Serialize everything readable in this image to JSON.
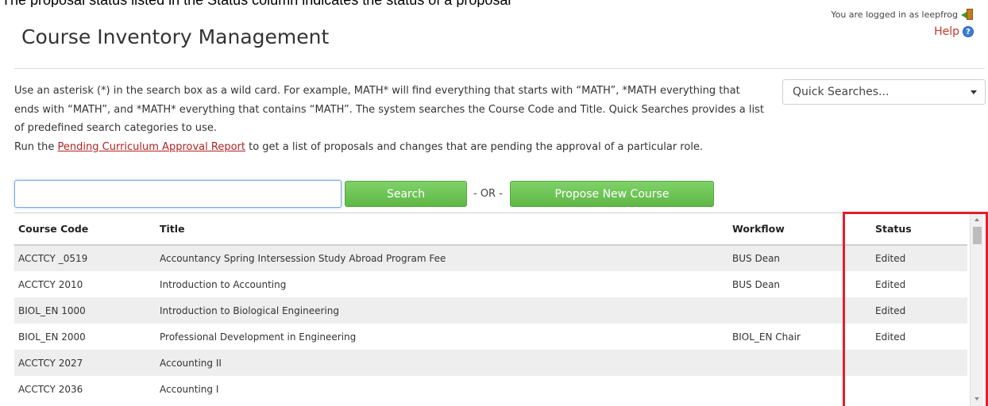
{
  "caption_fragment": "The proposal status listed in the Status column indicates the status of a proposal",
  "page": {
    "title": "Course Inventory Management"
  },
  "user": {
    "logged_in_text": "You are logged in as leepfrog",
    "help_label": "Help"
  },
  "instructions": {
    "paragraph": "Use an asterisk (*) in the search box as a wild card. For example, MATH* will find everything that starts with “MATH”, *MATH everything that ends with “MATH”, and *MATH* everything that contains “MATH”. The system searches the Course Code and Title. Quick Searches provides a list of predefined search categories to use.",
    "report_prefix": "Run the ",
    "report_link": "Pending Curriculum Approval Report",
    "report_suffix": " to get a list of proposals and changes that are pending the approval of a particular role."
  },
  "quick_searches": {
    "selected": "Quick Searches..."
  },
  "search": {
    "value": "",
    "button_label": "Search",
    "or_label": "- OR -",
    "propose_label": "Propose New Course"
  },
  "table": {
    "headers": {
      "code": "Course Code",
      "title": "Title",
      "workflow": "Workflow",
      "status": "Status"
    },
    "rows": [
      {
        "code": "ACCTCY _0519",
        "title": "Accountancy Spring Intersession Study Abroad Program Fee",
        "workflow": "BUS Dean",
        "status": "Edited"
      },
      {
        "code": "ACCTCY 2010",
        "title": "Introduction to Accounting",
        "workflow": "BUS Dean",
        "status": "Edited"
      },
      {
        "code": "BIOL_EN 1000",
        "title": "Introduction to Biological Engineering",
        "workflow": "",
        "status": "Edited"
      },
      {
        "code": "BIOL_EN 2000",
        "title": "Professional Development in Engineering",
        "workflow": "BIOL_EN Chair",
        "status": "Edited"
      },
      {
        "code": "ACCTCY 2027",
        "title": "Accounting II",
        "workflow": "",
        "status": ""
      },
      {
        "code": "ACCTCY 2036",
        "title": "Accounting I",
        "workflow": "",
        "status": ""
      }
    ]
  },
  "colors": {
    "button_green": "#5fb845",
    "link_red": "#b22222",
    "highlight_red": "#e0202a",
    "row_stripe": "#eeeeee"
  },
  "icons": {
    "logout": "door-exit-icon",
    "help": "help-question-icon",
    "dropdown": "chevron-down-icon"
  }
}
